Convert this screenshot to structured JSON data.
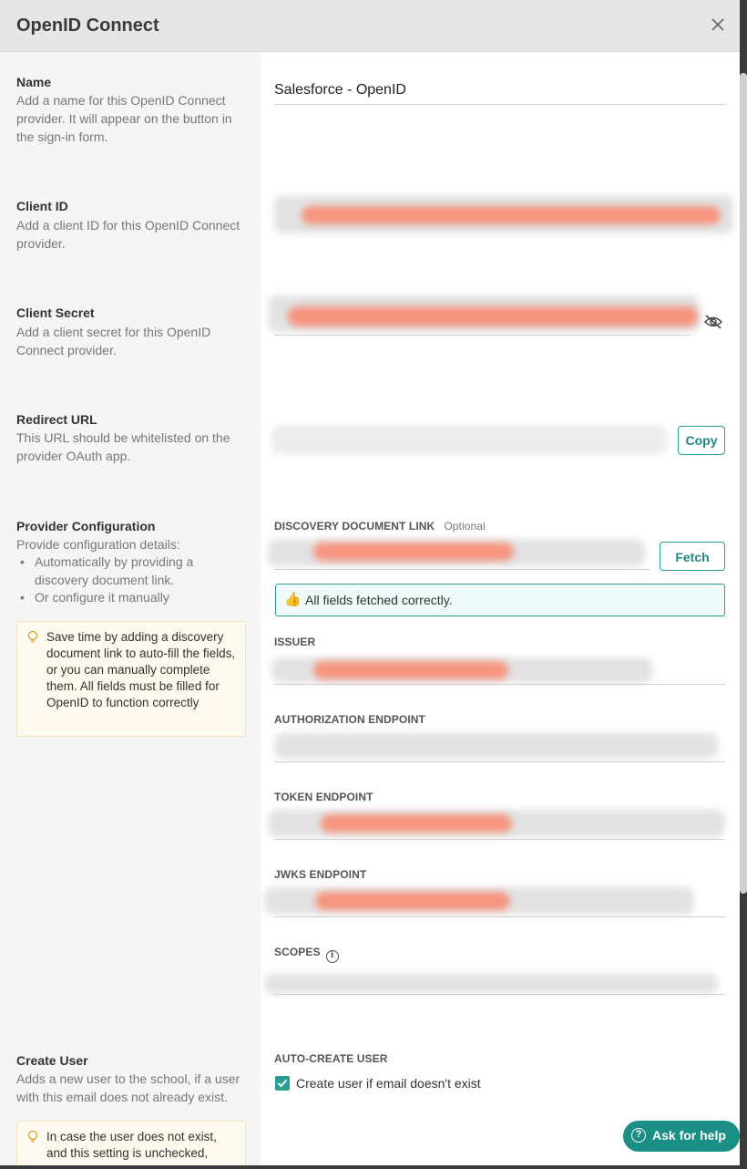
{
  "modal": {
    "title": "OpenID Connect"
  },
  "sections": {
    "name": {
      "title": "Name",
      "description": "Add a name for this OpenID Connect provider. It will appear on the button in the sign-in form.",
      "value": "Salesforce - OpenID"
    },
    "client_id": {
      "title": "Client ID",
      "description": "Add a client ID for this OpenID Connect provider."
    },
    "client_secret": {
      "title": "Client Secret",
      "description": "Add a client secret for this OpenID Connect provider.",
      "icon": "eye-off-icon"
    },
    "redirect_url": {
      "title": "Redirect URL",
      "description": "This URL should be whitelisted on the provider OAuth app.",
      "copy_label": "Copy"
    },
    "provider_config": {
      "title": "Provider Configuration",
      "description": "Provide configuration details:",
      "options": [
        "Automatically by providing a discovery document link.",
        "Or configure it manually"
      ],
      "tip": "Save time by adding a discovery document link to auto-fill the fields, or you can manually complete them. All fields must be filled for OpenID to function correctly",
      "tip_icon": "lightbulb-icon"
    },
    "create_user": {
      "title": "Create User",
      "description": "Adds a new user to the school, if a user with this email does not already exist.",
      "tip": "In case the user does not exist, and this setting is unchecked,",
      "tip_icon": "lightbulb-icon"
    }
  },
  "provider_fields": {
    "discovery_label": "DISCOVERY DOCUMENT LINK",
    "discovery_optional": "Optional",
    "fetch_label": "Fetch",
    "success_message": "All fields fetched correctly.",
    "success_icon": "thumbs-up-icon",
    "issuer_label": "ISSUER",
    "authorization_label": "AUTHORIZATION ENDPOINT",
    "token_label": "TOKEN ENDPOINT",
    "jwks_label": "JWKS ENDPOINT",
    "scopes_label": "SCOPES",
    "scopes_icon": "info-icon"
  },
  "auto_create": {
    "label": "AUTO-CREATE USER",
    "checkbox_label": "Create user if email doesn't exist",
    "checked": true
  },
  "help": {
    "label": "Ask for help",
    "icon": "question-circle-icon"
  },
  "colors": {
    "accent": "#2a9d94",
    "header_bg": "#e6e6e6",
    "left_col_bg": "#f5f5f5",
    "tip_bg": "#fffaf0",
    "redacted": "#f6947e"
  }
}
